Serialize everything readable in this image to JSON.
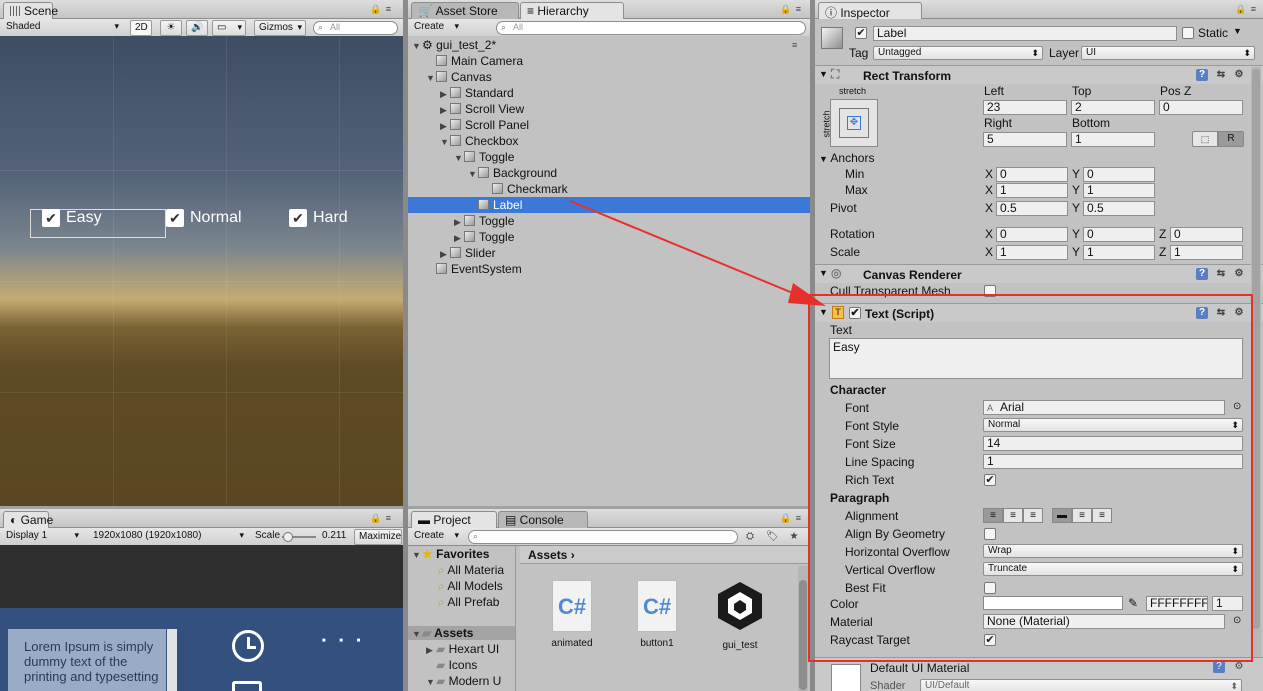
{
  "scene": {
    "tab": "Scene",
    "shading": "Shaded",
    "mode2d": "2D",
    "gizmos": "Gizmos",
    "search_placeholder": "All",
    "toggles": [
      "Easy",
      "Normal",
      "Hard"
    ]
  },
  "game": {
    "tab": "Game",
    "display": "Display 1",
    "resolution": "1920x1080 (1920x1080)",
    "scale_label": "Scale",
    "scale_value": "0.211",
    "maximize": "Maximize",
    "lorem": "Lorem Ipsum is simply dummy text of the printing and typesetting"
  },
  "asset_store": {
    "tab": "Asset Store"
  },
  "hierarchy": {
    "tab": "Hierarchy",
    "create": "Create",
    "search_placeholder": "All",
    "scene_name": "gui_test_2*",
    "items": [
      {
        "label": "Main Camera",
        "indent": 1,
        "arrow": ""
      },
      {
        "label": "Canvas",
        "indent": 1,
        "arrow": "▼"
      },
      {
        "label": "Standard",
        "indent": 2,
        "arrow": "▶"
      },
      {
        "label": "Scroll View",
        "indent": 2,
        "arrow": "▶"
      },
      {
        "label": "Scroll Panel",
        "indent": 2,
        "arrow": "▶"
      },
      {
        "label": "Checkbox",
        "indent": 2,
        "arrow": "▼"
      },
      {
        "label": "Toggle",
        "indent": 3,
        "arrow": "▼"
      },
      {
        "label": "Background",
        "indent": 4,
        "arrow": "▼"
      },
      {
        "label": "Checkmark",
        "indent": 5,
        "arrow": ""
      },
      {
        "label": "Label",
        "indent": 4,
        "arrow": "",
        "selected": true
      },
      {
        "label": "Toggle",
        "indent": 3,
        "arrow": "▶"
      },
      {
        "label": "Toggle",
        "indent": 3,
        "arrow": "▶"
      },
      {
        "label": "Slider",
        "indent": 2,
        "arrow": "▶"
      },
      {
        "label": "EventSystem",
        "indent": 1,
        "arrow": ""
      }
    ]
  },
  "project": {
    "tab": "Project",
    "console_tab": "Console",
    "create": "Create",
    "favorites": "Favorites",
    "fav_items": [
      "All Materia",
      "All Models",
      "All Prefab"
    ],
    "assets_root": "Assets",
    "asset_folders": [
      "Hexart UI",
      "Icons",
      "Modern U"
    ],
    "breadcrumb": "Assets",
    "assets": [
      {
        "name": "animated",
        "kind": "cs"
      },
      {
        "name": "button1",
        "kind": "cs"
      },
      {
        "name": "gui_test",
        "kind": "unity"
      }
    ]
  },
  "inspector": {
    "tab": "Inspector",
    "object_name": "Label",
    "static_label": "Static",
    "tag_label": "Tag",
    "tag_value": "Untagged",
    "layer_label": "Layer",
    "layer_value": "UI",
    "rect_transform": {
      "title": "Rect Transform",
      "stretch": "stretch",
      "left_label": "Left",
      "left": "23",
      "top_label": "Top",
      "top": "2",
      "posz_label": "Pos Z",
      "posz": "0",
      "right_label": "Right",
      "right": "5",
      "bottom_label": "Bottom",
      "bottom": "1",
      "r_button": "R",
      "anchors": "Anchors",
      "min": "Min",
      "min_x": "0",
      "min_y": "0",
      "max": "Max",
      "max_x": "1",
      "max_y": "1",
      "pivot": "Pivot",
      "pivot_x": "0.5",
      "pivot_y": "0.5",
      "rotation": "Rotation",
      "rot_x": "0",
      "rot_y": "0",
      "rot_z": "0",
      "scale": "Scale",
      "scale_x": "1",
      "scale_y": "1",
      "scale_z": "1"
    },
    "canvas_renderer": {
      "title": "Canvas Renderer",
      "cull": "Cull Transparent Mesh"
    },
    "text_script": {
      "title": "Text (Script)",
      "text_label": "Text",
      "text_value": "Easy",
      "character": "Character",
      "font_label": "Font",
      "font_value": "Arial",
      "font_style_label": "Font Style",
      "font_style": "Normal",
      "font_size_label": "Font Size",
      "font_size": "14",
      "line_spacing_label": "Line Spacing",
      "line_spacing": "1",
      "rich_text_label": "Rich Text",
      "paragraph": "Paragraph",
      "alignment_label": "Alignment",
      "align_geom_label": "Align By Geometry",
      "h_overflow_label": "Horizontal Overflow",
      "h_overflow": "Wrap",
      "v_overflow_label": "Vertical Overflow",
      "v_overflow": "Truncate",
      "best_fit_label": "Best Fit",
      "color_label": "Color",
      "color_hex": "FFFFFFFF",
      "color_alpha": "1",
      "material_label": "Material",
      "material_value": "None (Material)",
      "raycast_label": "Raycast Target"
    },
    "default_material": {
      "title": "Default UI Material",
      "shader_label": "Shader",
      "shader_value": "UI/Default"
    }
  },
  "colors": {
    "highlight_red": "#e8302a",
    "selection_blue": "#3b78d8"
  }
}
